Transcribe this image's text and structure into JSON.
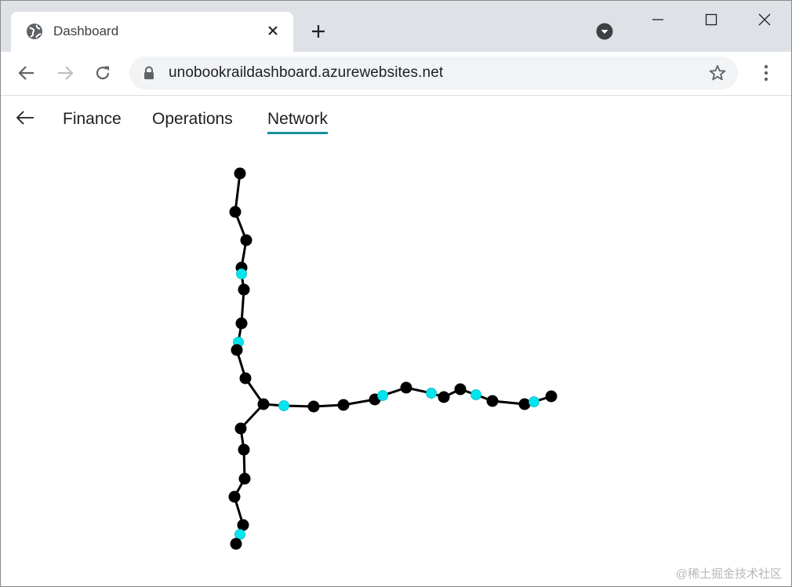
{
  "browser": {
    "tab_title": "Dashboard",
    "url": "unobookraildashboard.azurewebsites.net",
    "icons": {
      "favicon": "globe-icon",
      "tab_close": "close-icon",
      "new_tab": "plus-icon",
      "profile": "chevron-down-circle-icon",
      "minimize": "minimize-icon",
      "maximize": "maximize-icon",
      "close_window": "close-icon",
      "back": "arrow-left-icon",
      "forward": "arrow-right-icon",
      "reload": "reload-icon",
      "lock": "lock-icon",
      "bookmark": "star-icon",
      "menu": "kebab-menu-icon"
    }
  },
  "app": {
    "back_icon": "arrow-left-icon",
    "tabs": [
      {
        "label": "Finance",
        "active": false
      },
      {
        "label": "Operations",
        "active": false
      },
      {
        "label": "Network",
        "active": true
      }
    ],
    "accent_color": "#188f9e"
  },
  "network": {
    "station_color": "#000000",
    "highlight_color": "#00e5ee",
    "line_color": "#000000",
    "north_branch": [
      {
        "hl": false
      },
      {
        "hl": false
      },
      {
        "hl": false
      },
      {
        "hl": false
      },
      {
        "hl": true
      },
      {
        "hl": false
      },
      {
        "hl": false
      },
      {
        "hl": true
      },
      {
        "hl": false
      },
      {
        "hl": false
      }
    ],
    "junction": {
      "hl": false
    },
    "east_branch": [
      {
        "hl": true
      },
      {
        "hl": false
      },
      {
        "hl": false
      },
      {
        "hl": false
      },
      {
        "hl": true
      },
      {
        "hl": false
      },
      {
        "hl": true
      },
      {
        "hl": false
      },
      {
        "hl": false
      },
      {
        "hl": true
      },
      {
        "hl": false
      },
      {
        "hl": false
      },
      {
        "hl": true
      },
      {
        "hl": false
      }
    ],
    "south_branch": [
      {
        "hl": false
      },
      {
        "hl": false
      },
      {
        "hl": false
      },
      {
        "hl": false
      },
      {
        "hl": false
      },
      {
        "hl": true
      },
      {
        "hl": false
      }
    ]
  },
  "watermark": "@稀土掘金技术社区"
}
